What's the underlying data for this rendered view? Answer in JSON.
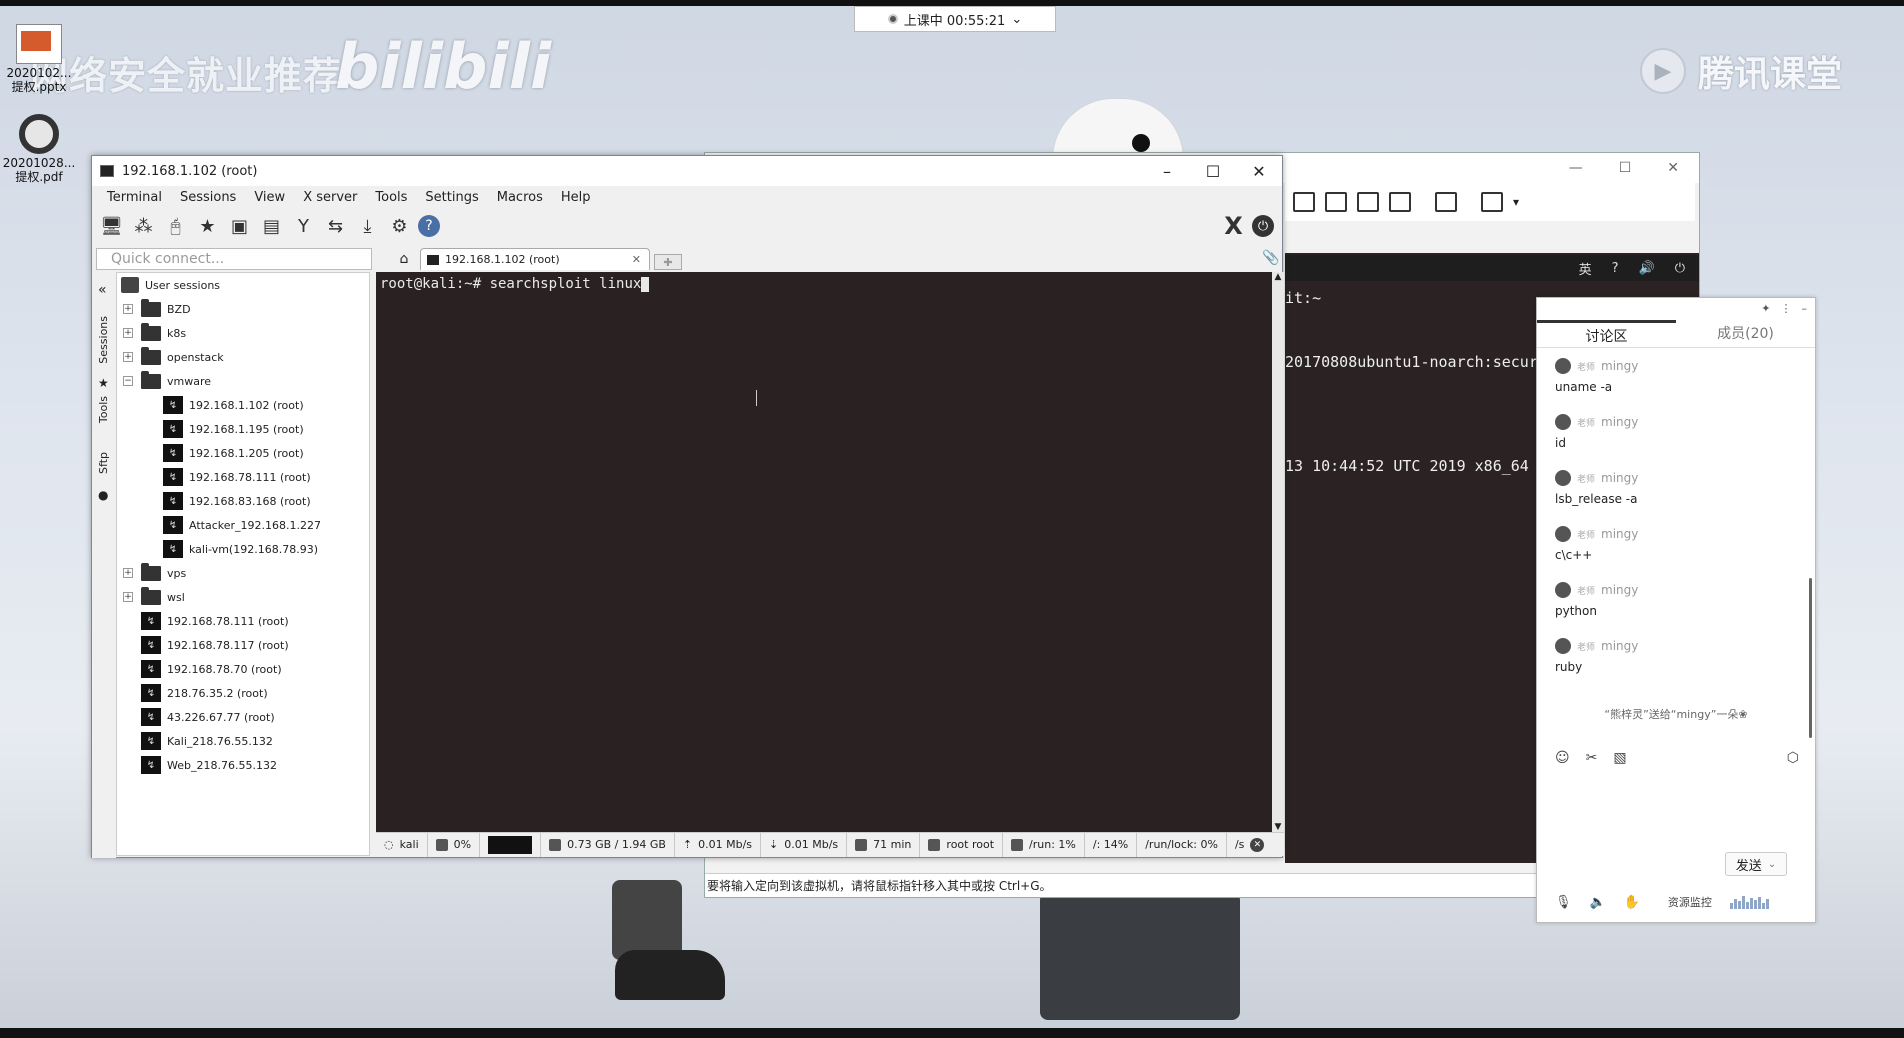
{
  "class_timer": {
    "status": "上课中 00:55:21",
    "chevron": "⌄"
  },
  "watermarks": {
    "left_text": "网络安全就业推荐",
    "bili_text": "bilibili",
    "right_text": "腾讯课堂"
  },
  "desktop_icons": [
    {
      "label": "2020102...\n提权.pptx"
    },
    {
      "label": "20201028...\n提权.pdf"
    }
  ],
  "vm_window": {
    "panel_lang": "英",
    "lines": [
      {
        "text": "it:~"
      },
      {
        "text": "20170808ubuntu1-noarch:secur"
      },
      {
        "text": "13 10:44:52 UTC 2019 x86_64"
      }
    ],
    "status_hint": "要将输入定向到该虚拟机，请将鼠标指针移入其中或按 Ctrl+G。"
  },
  "moba": {
    "title": "192.168.1.102 (root)",
    "menu": [
      "Terminal",
      "Sessions",
      "View",
      "X server",
      "Tools",
      "Settings",
      "Macros",
      "Help"
    ],
    "quick_connect_placeholder": "Quick connect...",
    "tab_label": "192.168.1.102 (root)",
    "side_tabs": [
      "Sessions",
      "Tools",
      "Sftp"
    ],
    "tree": {
      "root": "User sessions",
      "folders_top": [
        "BZD",
        "k8s",
        "openstack",
        "vmware"
      ],
      "vmware_children": [
        "192.168.1.102 (root)",
        "192.168.1.195 (root)",
        "192.168.1.205 (root)",
        "192.168.78.111 (root)",
        "192.168.83.168 (root)",
        "Attacker_192.168.1.227",
        "kali-vm(192.168.78.93)"
      ],
      "folders_mid": [
        "vps",
        "wsl"
      ],
      "sessions": [
        "192.168.78.111 (root)",
        "192.168.78.117 (root)",
        "192.168.78.70 (root)",
        "218.76.35.2 (root)",
        "43.226.67.77 (root)",
        "Kali_218.76.55.132",
        "Web_218.76.55.132"
      ]
    },
    "terminal": {
      "prompt": "root@kali:~# ",
      "command": "searchsploit linux"
    },
    "status": {
      "host": "kali",
      "cpu": "0%",
      "mem": "0.73 GB / 1.94 GB",
      "up": "0.01 Mb/s",
      "down": "0.01 Mb/s",
      "uptime": "71 min",
      "user": "root  root",
      "run": "/run: 1%",
      "root_fs": "/: 14%",
      "runlock": "/run/lock: 0%",
      "last": "/s"
    }
  },
  "chat": {
    "tab_active": "讨论区",
    "tab_members": "成员(20)",
    "sender_badge": "老师",
    "messages": [
      {
        "sender": "mingy",
        "text": "uname -a"
      },
      {
        "sender": "mingy",
        "text": "id"
      },
      {
        "sender": "mingy",
        "text": "lsb_release -a"
      },
      {
        "sender": "mingy",
        "text": "c\\c++"
      },
      {
        "sender": "mingy",
        "text": "python"
      },
      {
        "sender": "mingy",
        "text": "ruby"
      }
    ],
    "system_note": "“熊梓灵”送给“mingy”一朵❀",
    "send_label": "发送",
    "resource_label": "资源监控"
  },
  "colors": {
    "terminal_bg": "#2a2222",
    "terminal_fg": "#eaeaea",
    "chat_accent": "#333333"
  }
}
